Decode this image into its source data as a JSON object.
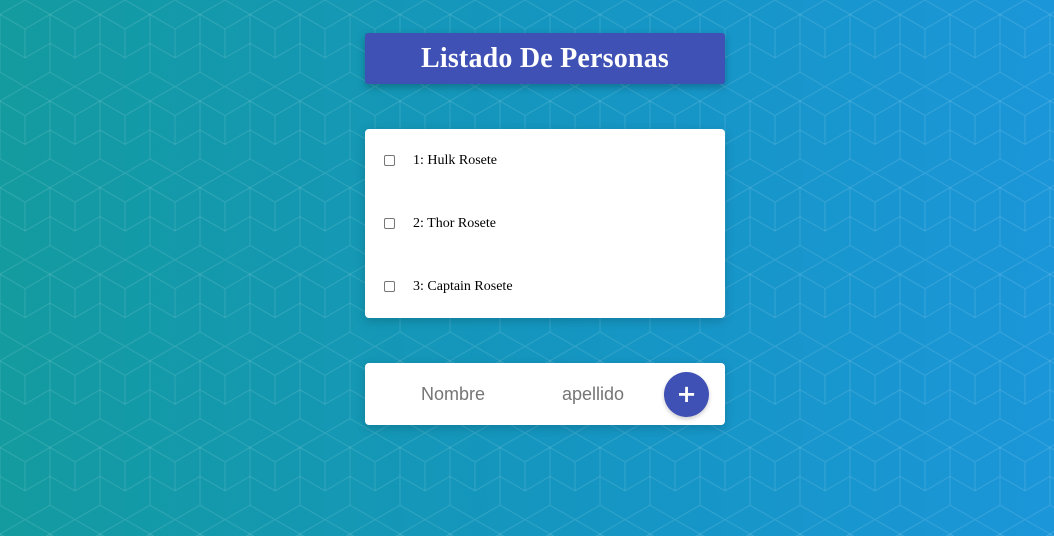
{
  "colors": {
    "primary": "#3f51b5",
    "background_start": "#139b9f",
    "background_end": "#1b96d9",
    "card": "#ffffff"
  },
  "header": {
    "title": "Listado De Personas"
  },
  "personas": [
    {
      "label": "1: Hulk Rosete",
      "checked": false
    },
    {
      "label": "2: Thor Rosete",
      "checked": false
    },
    {
      "label": "3: Captain Rosete",
      "checked": false
    }
  ],
  "form": {
    "nombre_placeholder": "Nombre",
    "apellido_placeholder": "apellido",
    "nombre_value": "",
    "apellido_value": "",
    "add_button_label": "+",
    "add_button_icon": "plus-icon"
  }
}
